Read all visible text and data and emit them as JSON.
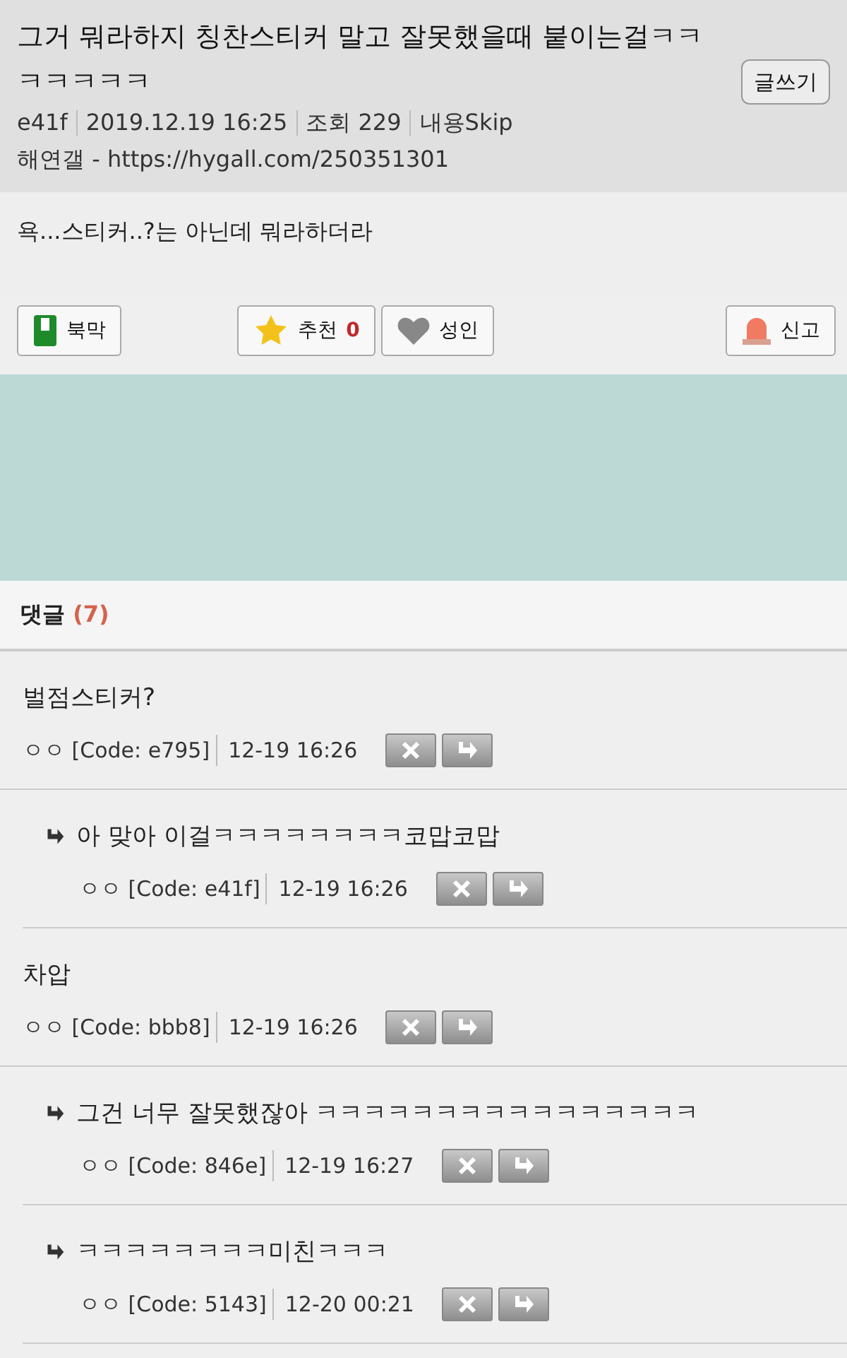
{
  "post": {
    "title": "그거 뭐라하지 칭찬스티커 말고 잘못했을때 붙이는걸ㅋㅋㅋㅋㅋㅋㅋ",
    "write_button": "글쓰기",
    "meta": [
      "e41f",
      "2019.12.19 16:25",
      "조회 229",
      "내용Skip"
    ],
    "source": "해연갤 - https://hygall.com/250351301",
    "body": "욕...스티커..?는 아닌데 뭐라하더라"
  },
  "actions": [
    {
      "kind": "bookmark",
      "label": "북막"
    },
    {
      "kind": "recommend",
      "label": "추천",
      "count": "0"
    },
    {
      "kind": "adult",
      "label": "성인"
    },
    {
      "kind": "report",
      "label": "신고"
    }
  ],
  "comments_header": {
    "label": "댓글",
    "count": "(7)"
  },
  "comments": [
    {
      "text": "벌점스티커?",
      "author": "ㅇㅇ",
      "code": "[Code: e795]",
      "time": "12-19 16:26",
      "children": [
        {
          "text": "아 맞아 이걸ㅋㅋㅋㅋㅋㅋㅋㅋ코맙코맙",
          "author": "ㅇㅇ",
          "code": "[Code: e41f]",
          "time": "12-19 16:26"
        }
      ]
    },
    {
      "text": "차압",
      "author": "ㅇㅇ",
      "code": "[Code: bbb8]",
      "time": "12-19 16:26",
      "children": [
        {
          "text": "그건 너무 잘못했잖아 ㅋㅋㅋㅋㅋㅋㅋㅋㅋㅋㅋㅋㅋㅋㅋㅋ",
          "author": "ㅇㅇ",
          "code": "[Code: 846e]",
          "time": "12-19 16:27"
        },
        {
          "text": "ㅋㅋㅋㅋㅋㅋㅋㅋ미친ㅋㅋㅋ",
          "author": "ㅇㅇ",
          "code": "[Code: 5143]",
          "time": "12-20 00:21"
        }
      ]
    }
  ]
}
